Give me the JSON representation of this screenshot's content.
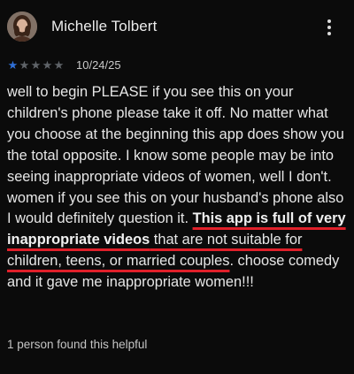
{
  "review": {
    "reviewer_name": "Michelle Tolbert",
    "avatar_icon": "profile-photo",
    "more_icon": "more-vert-icon",
    "rating": {
      "value": 1,
      "max": 5,
      "filled_color": "#2f6fd6",
      "empty_color": "#5f6368"
    },
    "date": "10/24/25",
    "body": {
      "part1": "well to begin PLEASE if you see this on your children's phone please take it off. No matter what you choose at the beginning this app does show you the total opposite. I know some people may be into seeing inappropriate videos of women, well I don't. women if you see this on your husband's phone also I would definitely question it. ",
      "part2_bold": "This app is full of very inappropriate videos",
      "part3": " that are not suitable for children, teens, or married couples",
      "part4": ". choose comedy and it gave me inappropriate women!!!"
    },
    "underline_color": "#e0202a",
    "helpful_text": "1 person found this helpful"
  }
}
